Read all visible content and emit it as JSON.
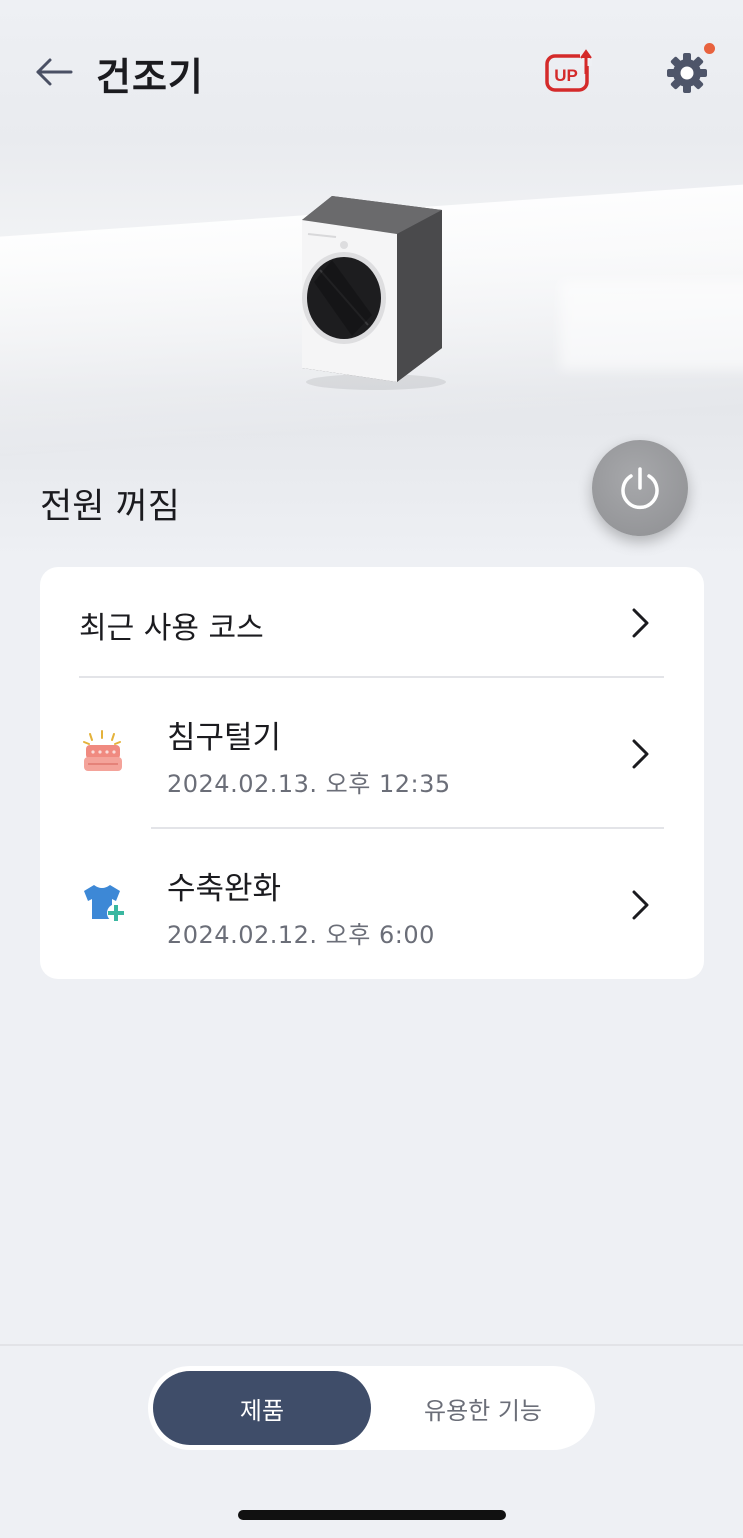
{
  "header": {
    "title": "건조기",
    "back_icon": "arrow-left-icon",
    "up_icon": "up-badge-icon",
    "settings_icon": "gear-icon",
    "notification_color": "#e8623e"
  },
  "device": {
    "image": "dryer-illustration",
    "status": "전원 꺼짐",
    "power_icon": "power-icon"
  },
  "recent_courses": {
    "header_label": "최근 사용 코스",
    "items": [
      {
        "name": "침구털기",
        "date": "2024.02.13. 오후 12:35",
        "icon": "bedding-icon"
      },
      {
        "name": "수축완화",
        "date": "2024.02.12. 오후 6:00",
        "icon": "shirt-plus-icon"
      }
    ]
  },
  "bottom_tabs": {
    "active": "제품",
    "other": "유용한 기능",
    "active_color": "#3f4d69"
  }
}
